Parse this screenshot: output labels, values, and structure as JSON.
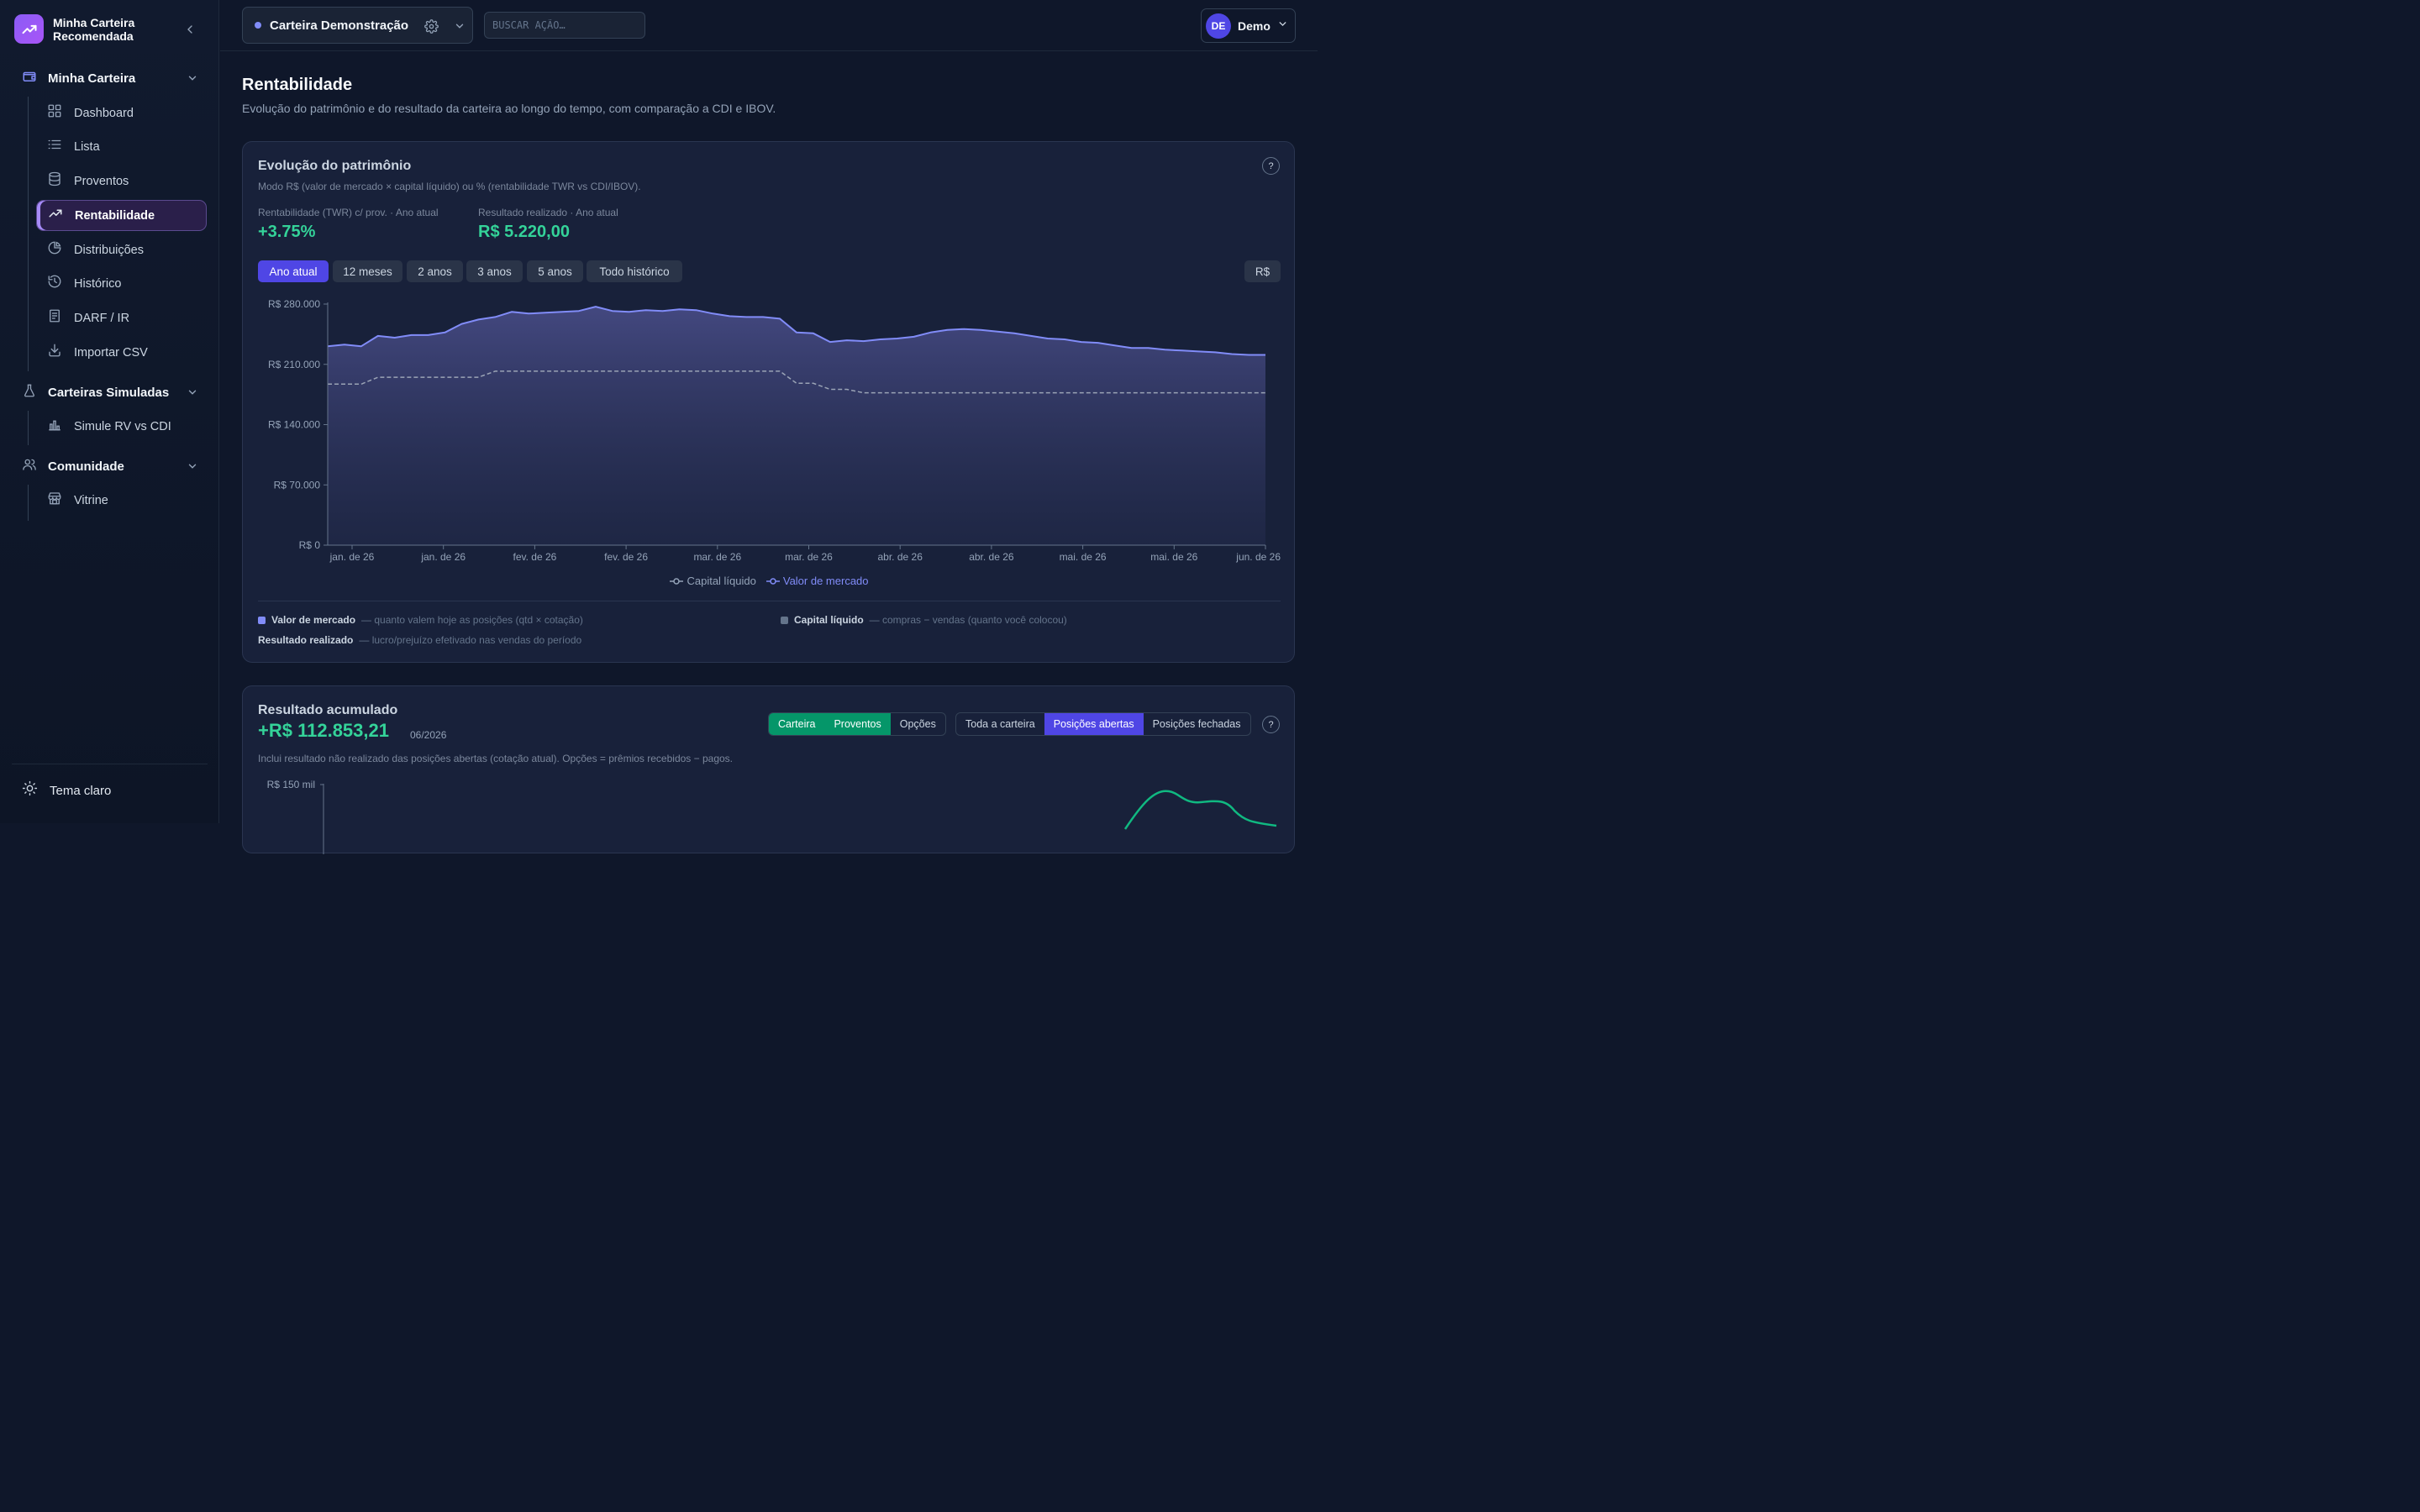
{
  "brand": {
    "title": "Minha Carteira Recomendada"
  },
  "sidebar": {
    "sections": [
      {
        "label": "Minha Carteira"
      },
      {
        "label": "Carteiras Simuladas"
      },
      {
        "label": "Comunidade"
      }
    ],
    "items": [
      {
        "label": "Dashboard",
        "icon": "grid-icon"
      },
      {
        "label": "Lista",
        "icon": "list-icon"
      },
      {
        "label": "Proventos",
        "icon": "database-icon"
      },
      {
        "label": "Rentabilidade",
        "icon": "trending-up-icon",
        "active": true
      },
      {
        "label": "Distribuições",
        "icon": "pie-chart-icon"
      },
      {
        "label": "Histórico",
        "icon": "history-icon"
      },
      {
        "label": "DARF / IR",
        "icon": "receipt-icon"
      },
      {
        "label": "Importar CSV",
        "icon": "download-icon"
      },
      {
        "label": "Simule RV vs CDI",
        "icon": "bar-chart-icon"
      },
      {
        "label": "Vitrine",
        "icon": "store-icon"
      }
    ],
    "theme_toggle": "Tema claro"
  },
  "topbar": {
    "wallet": "Carteira Demonstração",
    "search_placeholder": "BUSCAR AÇÃO…",
    "user_initials": "DE",
    "user_name": "Demo"
  },
  "page": {
    "title": "Rentabilidade",
    "subtitle": "Evolução do patrimônio e do resultado da carteira ao longo do tempo, com comparação a CDI e IBOV."
  },
  "card1": {
    "title": "Evolução do patrimônio",
    "subtitle": "Modo R$ (valor de mercado × capital líquido) ou % (rentabilidade TWR vs CDI/IBOV).",
    "help": "?",
    "kpis": [
      {
        "label": "Rentabilidade (TWR) c/ prov. · Ano atual",
        "value": "+3.75%"
      },
      {
        "label": "Resultado realizado · Ano atual",
        "value": "R$ 5.220,00"
      }
    ],
    "ranges": [
      "Ano atual",
      "12 meses",
      "2 anos",
      "3 anos",
      "5 anos",
      "Todo histórico"
    ],
    "active_range": "Ano atual",
    "mode": "R$",
    "explanations": [
      {
        "term": "Valor de mercado",
        "desc": "— quanto valem hoje as posições (qtd × cotação)"
      },
      {
        "term": "Capital líquido",
        "desc": "— compras − vendas (quanto você colocou)"
      },
      {
        "term": "Resultado realizado",
        "desc": "— lucro/prejuízo efetivado nas vendas do período"
      }
    ],
    "colors": {
      "market": "#818cf8",
      "capital": "#94a3b8",
      "positive": "#34d399"
    }
  },
  "chart_data": {
    "type": "area",
    "title": "",
    "xlabel": "",
    "ylabel": "",
    "ylim": [
      0,
      280000
    ],
    "yticks": [
      "R$ 0",
      "R$ 70.000",
      "R$ 140.000",
      "R$ 210.000",
      "R$ 280.000"
    ],
    "xticks": [
      "jan. de 26",
      "jan. de 26",
      "fev. de 26",
      "fev. de 26",
      "mar. de 26",
      "mar. de 26",
      "abr. de 26",
      "abr. de 26",
      "mai. de 26",
      "mai. de 26",
      "jun. de 26"
    ],
    "legend": [
      "Capital líquido",
      "Valor de mercado"
    ],
    "legend_position": "bottom-center",
    "series": [
      {
        "name": "Valor de mercado",
        "values": [
          231000,
          233000,
          231000,
          243000,
          241000,
          244000,
          244000,
          247000,
          257000,
          262000,
          265000,
          271000,
          269000,
          270000,
          271000,
          272000,
          277000,
          272000,
          271000,
          273000,
          272000,
          274000,
          273000,
          269000,
          266000,
          265000,
          265000,
          263000,
          247000,
          246000,
          236000,
          238000,
          237000,
          239000,
          240000,
          242000,
          247000,
          250000,
          251000,
          250000,
          248000,
          246000,
          243000,
          240000,
          239000,
          236000,
          235000,
          232000,
          229000,
          229000,
          227000,
          226000,
          225000,
          224000,
          222000,
          221000,
          221000
        ]
      },
      {
        "name": "Capital líquido",
        "values": [
          187000,
          187000,
          187000,
          195000,
          195000,
          195000,
          195000,
          195000,
          195000,
          195000,
          202000,
          202000,
          202000,
          202000,
          202000,
          202000,
          202000,
          202000,
          202000,
          202000,
          202000,
          202000,
          202000,
          202000,
          202000,
          202000,
          202000,
          202000,
          188000,
          188000,
          181000,
          181000,
          177000,
          177000,
          177000,
          177000,
          177000,
          177000,
          177000,
          177000,
          177000,
          177000,
          177000,
          177000,
          177000,
          177000,
          177000,
          177000,
          177000,
          177000,
          177000,
          177000,
          177000,
          177000,
          177000,
          177000,
          177000
        ]
      }
    ]
  },
  "card2": {
    "title": "Resultado acumulado",
    "value": "+R$ 112.853,21",
    "date": "06/2026",
    "note": "Inclui resultado não realizado das posições abertas (cotação atual). Opções = prêmios recebidos − pagos.",
    "filter_a": [
      "Carteira",
      "Proventos",
      "Opções"
    ],
    "filter_b": [
      "Toda a carteira",
      "Posições abertas",
      "Posições fechadas"
    ],
    "y_top_label": "R$ 150 mil",
    "help": "?"
  }
}
